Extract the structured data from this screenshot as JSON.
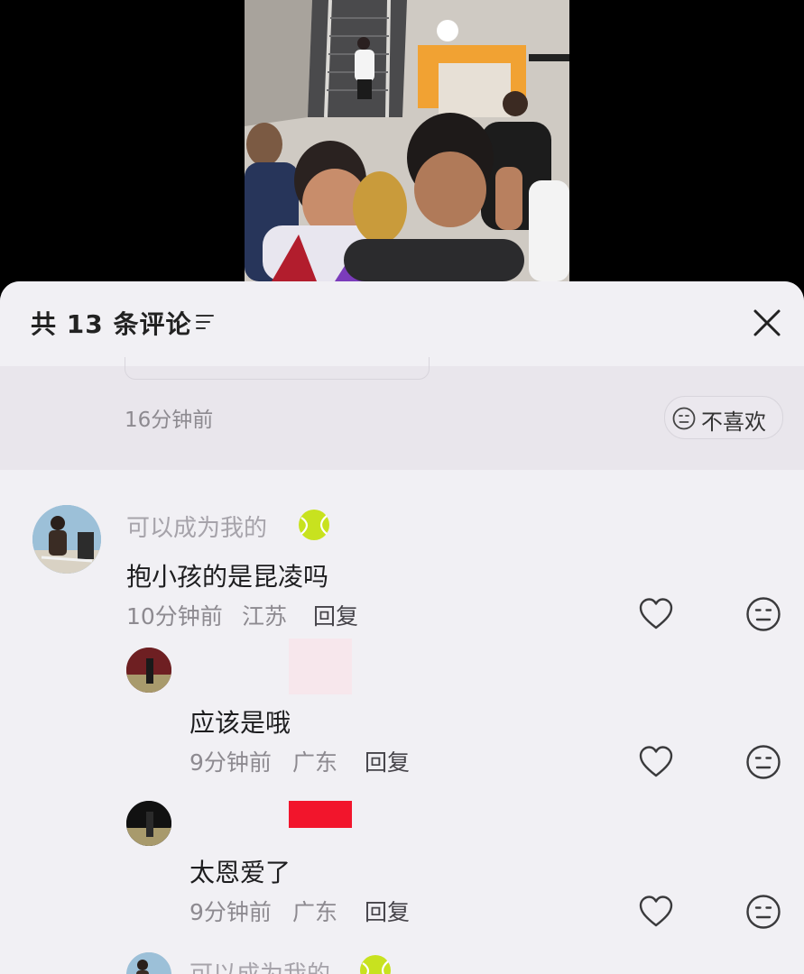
{
  "header": {
    "title": "共 13 条评论",
    "sort_icon": "sort-lines-icon",
    "close_icon": "close-icon"
  },
  "previous_comment": {
    "time": "16分钟前",
    "dislike_label": "不喜欢"
  },
  "comments": [
    {
      "username": "可以成为我的",
      "username_emoji": "tennis-ball-icon",
      "text": "抱小孩的是昆凌吗",
      "time": "10分钟前",
      "location": "江苏",
      "reply_label": "回复"
    },
    {
      "username": "",
      "text": "应该是哦",
      "time": "9分钟前",
      "location": "广东",
      "reply_label": "回复"
    },
    {
      "username": "",
      "text": "太恩爱了",
      "time": "9分钟前",
      "location": "广东",
      "reply_label": "回复"
    },
    {
      "username": "可以成为我的",
      "username_emoji": "tennis-ball-icon"
    }
  ],
  "colors": {
    "panel_bg": "#f1f0f4",
    "accent_red": "#f2152c",
    "text_primary": "#1d1d1f",
    "text_secondary": "#8d8a90"
  }
}
